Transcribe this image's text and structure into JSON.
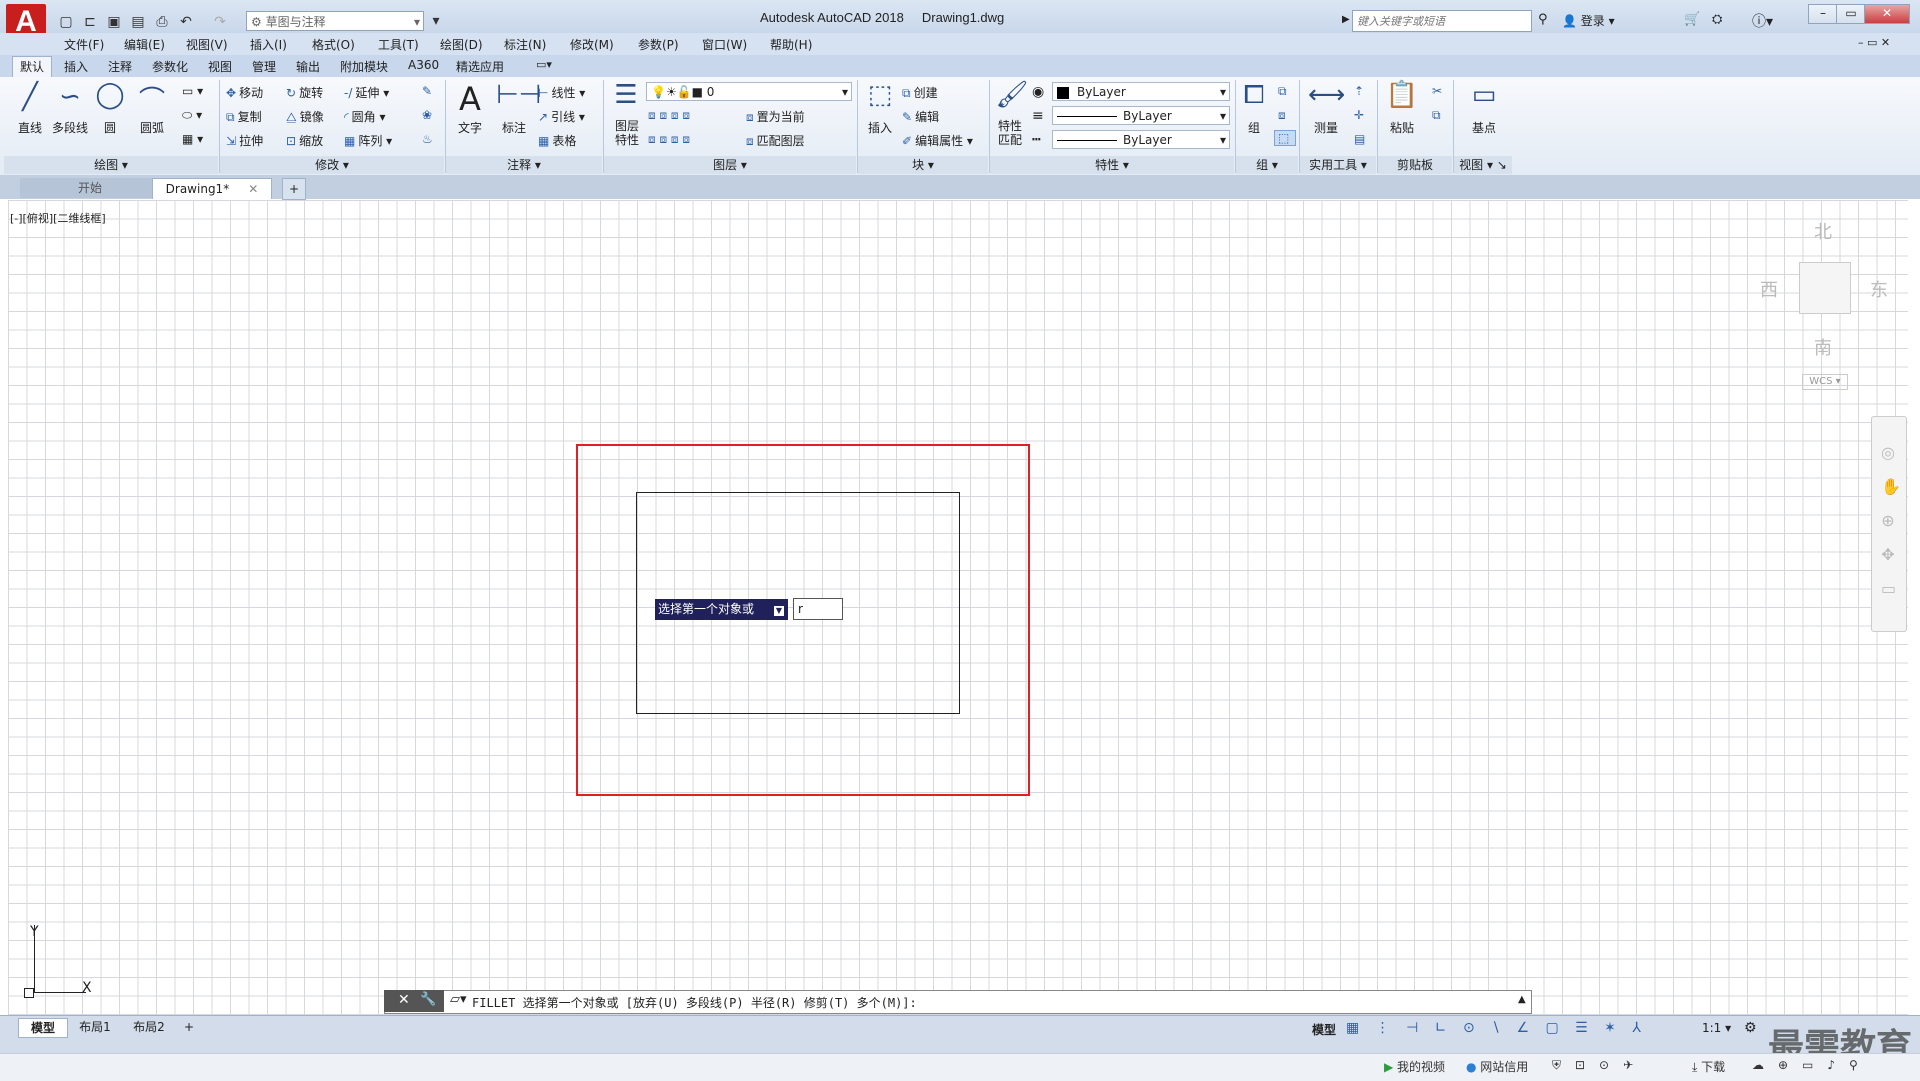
{
  "window": {
    "title": "Autodesk AutoCAD 2018",
    "document": "Drawing1.dwg",
    "logo": "A"
  },
  "quick_access": {
    "workspace": "草图与注释"
  },
  "search": {
    "placeholder": "键入关键字或短语"
  },
  "user": {
    "login": "登录"
  },
  "menu": [
    "文件(F)",
    "编辑(E)",
    "视图(V)",
    "插入(I)",
    "格式(O)",
    "工具(T)",
    "绘图(D)",
    "标注(N)",
    "修改(M)",
    "参数(P)",
    "窗口(W)",
    "帮助(H)"
  ],
  "ribbon_tabs": [
    "默认",
    "插入",
    "注释",
    "参数化",
    "视图",
    "管理",
    "输出",
    "附加模块",
    "A360",
    "精选应用"
  ],
  "ribbon": {
    "draw": {
      "title": "绘图",
      "line": "直线",
      "polyline": "多段线",
      "circle": "圆",
      "arc": "圆弧"
    },
    "modify": {
      "title": "修改",
      "move": "移动",
      "rotate": "旋转",
      "trim": "延伸",
      "copy": "复制",
      "mirror": "镜像",
      "fillet": "圆角",
      "stretch": "拉伸",
      "scale": "缩放",
      "array": "阵列"
    },
    "annotation": {
      "title": "注释",
      "text": "文字",
      "dimension": "标注",
      "linear": "线性",
      "leader": "引线",
      "table": "表格"
    },
    "layers": {
      "title": "图层",
      "props": "图层特性",
      "current_layer": "0",
      "make_current": "置为当前",
      "match": "匹配图层"
    },
    "block": {
      "title": "块",
      "insert": "插入",
      "create": "创建",
      "edit": "编辑",
      "edit_attr": "编辑属性"
    },
    "properties": {
      "title": "特性",
      "match": "特性匹配",
      "color": "ByLayer",
      "linetype": "ByLayer",
      "lineweight": "ByLayer"
    },
    "groups": {
      "title": "组",
      "group": "组"
    },
    "utilities": {
      "title": "实用工具",
      "measure": "测量"
    },
    "clipboard": {
      "title": "剪贴板",
      "paste": "粘贴"
    },
    "view": {
      "title": "视图",
      "base": "基点"
    }
  },
  "doc_tabs": {
    "start": "开始",
    "drawing": "Drawing1*",
    "add": "+"
  },
  "viewport": {
    "label": "[-][俯视][二维线框]",
    "north": "北",
    "south": "南",
    "east": "东",
    "west": "西",
    "wcs": "WCS"
  },
  "ucs": {
    "x": "X",
    "y": "Y"
  },
  "tooltip": {
    "text": "选择第一个对象或",
    "input": "r"
  },
  "command": {
    "text": "FILLET 选择第一个对象或 [放弃(U) 多段线(P) 半径(R) 修剪(T) 多个(M)]:"
  },
  "layout_tabs": [
    "模型",
    "布局1",
    "布局2",
    "+"
  ],
  "status": {
    "model": "模型",
    "scale": "1:1"
  },
  "taskbar": {
    "video": "我的视频",
    "credit": "网站信用",
    "download": "下载"
  },
  "watermark": "最需教育",
  "colors": {
    "accent_red": "#e12121",
    "tooltip_bg": "#20205a",
    "logo_red": "#c81e1e"
  }
}
